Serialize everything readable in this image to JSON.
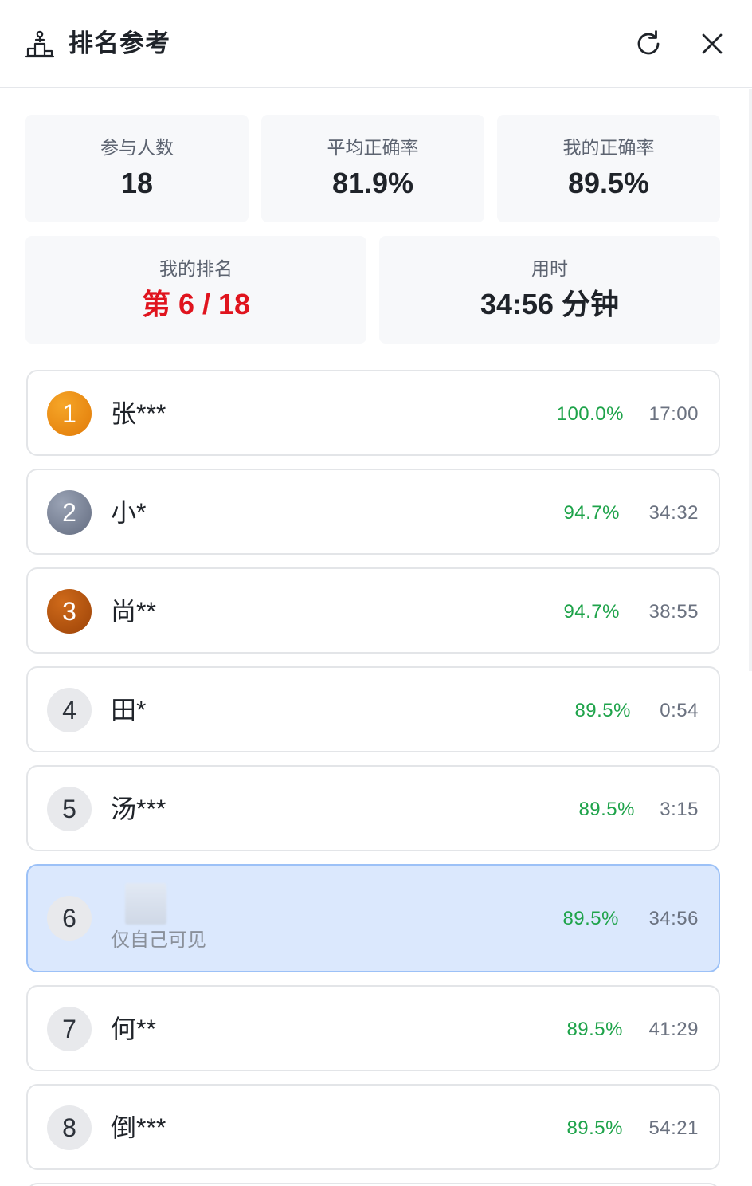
{
  "header": {
    "title": "排名参考",
    "icon": "podium-icon",
    "refresh_icon": "refresh-icon",
    "close_icon": "close-icon"
  },
  "stats": {
    "participants": {
      "label": "参与人数",
      "value": "18"
    },
    "avg_accuracy": {
      "label": "平均正确率",
      "value": "81.9%"
    },
    "my_accuracy": {
      "label": "我的正确率",
      "value": "89.5%"
    },
    "my_rank": {
      "label": "我的排名",
      "value": "第 6 / 18"
    },
    "time_used": {
      "label": "用时",
      "value": "34:56 分钟"
    }
  },
  "colors": {
    "accent_red": "#e0141e",
    "accuracy_green": "#1ea34a",
    "self_row_bg": "#dbe8fd",
    "gold": "#e17a08",
    "silver": "#636c80",
    "bronze": "#9c4308"
  },
  "rankings": [
    {
      "rank": "1",
      "name": "张***",
      "accuracy": "100.0%",
      "time": "17:00",
      "medal": "gold"
    },
    {
      "rank": "2",
      "name": "小*",
      "accuracy": "94.7%",
      "time": "34:32",
      "medal": "silver"
    },
    {
      "rank": "3",
      "name": "尚**",
      "accuracy": "94.7%",
      "time": "38:55",
      "medal": "bronze"
    },
    {
      "rank": "4",
      "name": "田*",
      "accuracy": "89.5%",
      "time": "0:54"
    },
    {
      "rank": "5",
      "name": "汤***",
      "accuracy": "89.5%",
      "time": "3:15"
    },
    {
      "rank": "6",
      "name": "",
      "note": "仅自己可见",
      "accuracy": "89.5%",
      "time": "34:56",
      "is_self": true
    },
    {
      "rank": "7",
      "name": "何**",
      "accuracy": "89.5%",
      "time": "41:29"
    },
    {
      "rank": "8",
      "name": "倒***",
      "accuracy": "89.5%",
      "time": "54:21"
    }
  ]
}
